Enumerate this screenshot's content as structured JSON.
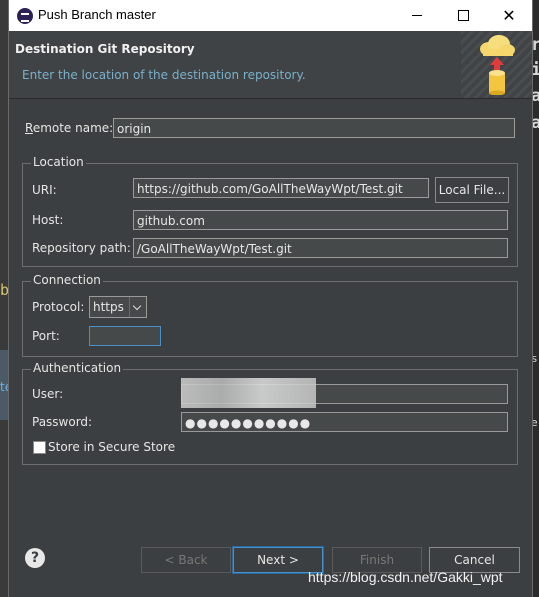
{
  "window": {
    "title": "Push Branch master"
  },
  "banner": {
    "title": "Destination Git Repository",
    "description": "Enter the location of the destination repository."
  },
  "remote": {
    "label": "Remote name:",
    "value": "origin"
  },
  "location": {
    "group_title": "Location",
    "uri_label": "URI:",
    "uri_value": "https://github.com/GoAllTheWayWpt/Test.git",
    "local_file_button": "Local File...",
    "host_label": "Host:",
    "host_value": "github.com",
    "repo_path_label": "Repository path:",
    "repo_path_value": "/GoAllTheWayWpt/Test.git"
  },
  "connection": {
    "group_title": "Connection",
    "protocol_label": "Protocol:",
    "protocol_value": "https",
    "port_label": "Port:",
    "port_value": ""
  },
  "authentication": {
    "group_title": "Authentication",
    "user_label": "User:",
    "user_value": "",
    "password_label": "Password:",
    "password_value": "●●●●●●●●●●●",
    "store_label": "Store in Secure Store",
    "store_checked": false
  },
  "buttons": {
    "back": "< Back",
    "next": "Next >",
    "finish": "Finish",
    "cancel": "Cancel"
  },
  "background": {
    "frag_r": "r",
    "frag_i": "i",
    "frag_a1": "a",
    "frag_a2": "a",
    "frag_b": "b",
    "frag_te": "te",
    "frag_s": "s",
    "frag_e": "e"
  },
  "watermark": "https://blog.csdn.net/Gakki_wpt",
  "icons": {
    "app": "eclipse-icon",
    "wizard": "git-push-cloud-icon",
    "help": "help-icon"
  }
}
